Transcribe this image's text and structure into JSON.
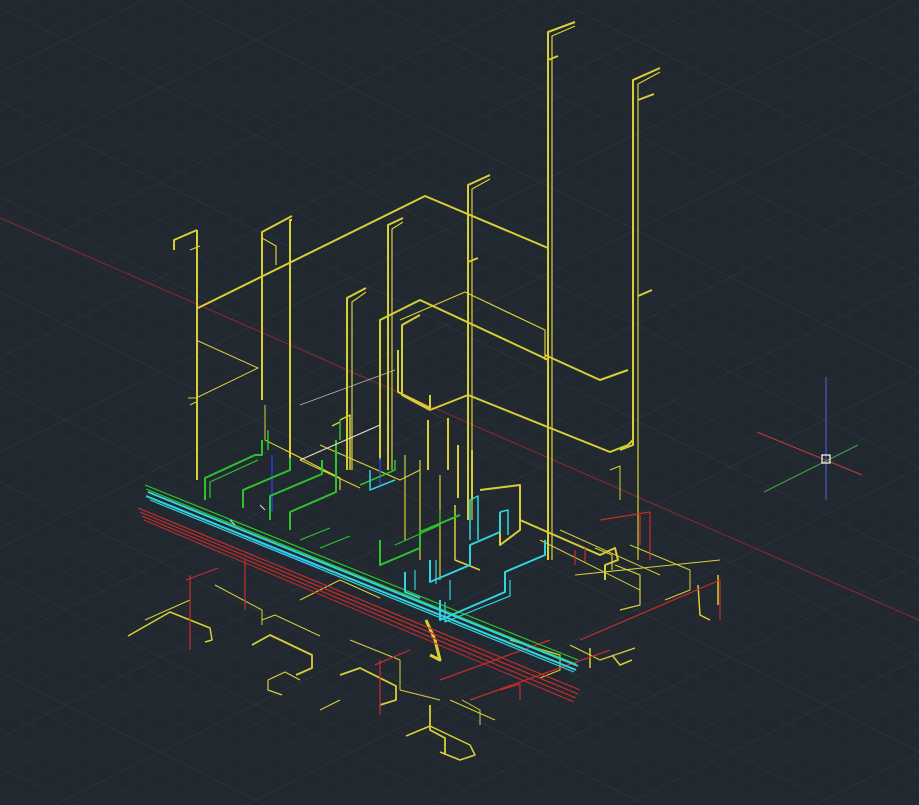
{
  "viewport": {
    "background": "#212830",
    "grid_minor_color": "#283038",
    "grid_major_color": "#2e3640",
    "visual_style": "3D Wireframe",
    "view": "SE Isometric"
  },
  "axes": {
    "x_color": "#c0393b",
    "y_color": "#3fa84a",
    "z_color": "#5b5fd6",
    "x_axis_color": "#8a2a2e"
  },
  "cursor": {
    "icon": "crosshair-pickbox-icon",
    "color": "#ffffff"
  },
  "model": {
    "description_icon": "piping-model-icon",
    "layers": [
      {
        "name": "yellow-piping",
        "color": "#e0d53a"
      },
      {
        "name": "cyan-piping",
        "color": "#35d8e0"
      },
      {
        "name": "green-piping",
        "color": "#2ec52e"
      },
      {
        "name": "red-piping",
        "color": "#d03030"
      },
      {
        "name": "blue-piping",
        "color": "#2b3fd8"
      }
    ]
  }
}
